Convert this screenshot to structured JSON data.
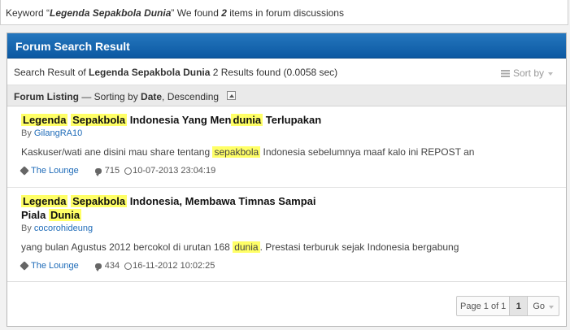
{
  "keyword_bar": {
    "prefix": "Keyword “",
    "keyword": "Legenda Sepakbola Dunia",
    "middle": "” We found ",
    "count": "2",
    "suffix": " items in forum discussions"
  },
  "panel": {
    "title": "Forum Search Result",
    "summary_prefix": "Search Result of ",
    "summary_keyword": "Legenda Sepakbola Dunia",
    "summary_suffix": " 2 Results found (0.0058 sec)",
    "sort_label": "Sort by"
  },
  "listing": {
    "label": "Forum Listing",
    "sorting_prefix": " — Sorting by ",
    "sort_field": "Date",
    "sort_order": ", Descending"
  },
  "threads": [
    {
      "title_parts": [
        "Legenda",
        " ",
        "Sepakbola",
        " Indonesia Yang Men",
        "dunia",
        " Terlupakan"
      ],
      "by_prefix": "By ",
      "author": "GilangRA10",
      "snippet_parts": [
        "Kaskuser/wati ane disini mau share tentang ",
        "sepakbola",
        " Indonesia sebelumnya maaf kalo ini REPOST an"
      ],
      "forum": "The Lounge",
      "replies": "715",
      "date": "10-07-2013 23:04:19"
    },
    {
      "title_parts": [
        "Legenda",
        " ",
        "Sepakbola",
        " Indonesia, Membawa Timnas Sampai",
        "Piala ",
        "Dunia"
      ],
      "by_prefix": "By ",
      "author": "cocorohideung",
      "snippet_parts": [
        "yang bulan Agustus 2012 bercokol di urutan 168 ",
        "dunia",
        ". Prestasi terburuk sejak Indonesia bergabung"
      ],
      "forum": "The Lounge",
      "replies": "434",
      "date": "16-11-2012 10:02:25"
    }
  ],
  "pager": {
    "label": "Page 1 of 1",
    "current": "1",
    "go": "Go"
  },
  "colors": {
    "header_blue": "#1667b0",
    "highlight": "#ffff66",
    "link": "#1e6bb8"
  },
  "icons": [
    "list-icon",
    "tag-icon",
    "comment-icon",
    "clock-icon",
    "collapse-icon"
  ]
}
